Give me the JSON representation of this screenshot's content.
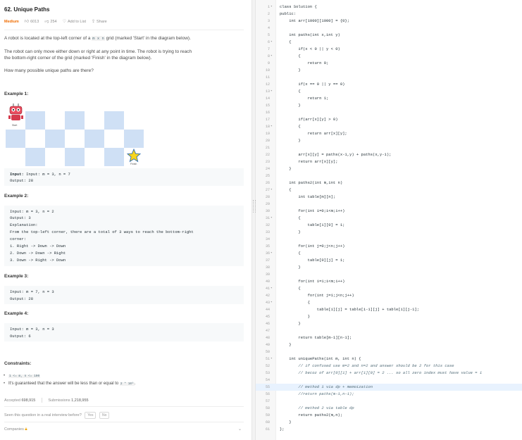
{
  "problem": {
    "title": "62. Unique Paths",
    "difficulty": "Medium",
    "likes": "6013",
    "dislikes": "254",
    "add_to_list": "Add to List",
    "share": "Share",
    "desc1_a": "A robot is located at the top-left corner of a ",
    "desc1_code": "m x n",
    "desc1_b": " grid (marked 'Start' in the diagram below).",
    "desc2_l1": "The robot can only move either down or right at any point in time. The robot is trying to reach",
    "desc2_l2": "the bottom-right corner of the grid (marked 'Finish' in the diagram below).",
    "desc3": "How many possible unique paths are there?",
    "start_label": "Start",
    "finish_label": "Finish",
    "examples": [
      {
        "title": "Example 1:",
        "lines": [
          "Input: m = 3, n = 7",
          "Output: 28"
        ]
      },
      {
        "title": "Example 2:",
        "lines": [
          "Input: m = 3, n = 2",
          "Output: 3",
          "Explanation:",
          "From the top-left corner, there are a total of 3 ways to reach the bottom-right",
          "corner:",
          "1. Right -> Down -> Down",
          "2. Down -> Down -> Right",
          "3. Down -> Right -> Down"
        ]
      },
      {
        "title": "Example 3:",
        "lines": [
          "Input: m = 7, n = 3",
          "Output: 28"
        ]
      },
      {
        "title": "Example 4:",
        "lines": [
          "Input: m = 3, n = 3",
          "Output: 6"
        ]
      }
    ],
    "constraints_title": "Constraints:",
    "constraint1": "1 <= m, n <= 100",
    "constraint2_a": "It's guaranteed that the answer will be less than or equal to ",
    "constraint2_code": "2 * 10⁹",
    "constraint2_b": ".",
    "accepted_label": "Accepted",
    "accepted_value": "698,915",
    "submissions_label": "Submissions",
    "submissions_value": "1,218,955",
    "interview_q": "Seen this question in a real interview before?",
    "yes": "Yes",
    "no": "No",
    "companies": "Companies"
  },
  "editor": {
    "lines": [
      {
        "n": "1",
        "fold": true,
        "t": "class Solution {"
      },
      {
        "n": "2",
        "t": "public:"
      },
      {
        "n": "3",
        "t": "    int arr[1000][1000] = {0};"
      },
      {
        "n": "4",
        "t": ""
      },
      {
        "n": "5",
        "t": "    int paths(int x,int y)"
      },
      {
        "n": "6",
        "fold": true,
        "t": "    {"
      },
      {
        "n": "7",
        "t": "        if(x < 0 || y < 0)"
      },
      {
        "n": "8",
        "fold": true,
        "t": "        {"
      },
      {
        "n": "9",
        "t": "            return 0;"
      },
      {
        "n": "10",
        "t": "        }"
      },
      {
        "n": "11",
        "t": ""
      },
      {
        "n": "12",
        "t": "        if(x == 0 || y == 0)"
      },
      {
        "n": "13",
        "fold": true,
        "t": "        {"
      },
      {
        "n": "14",
        "t": "            return 1;"
      },
      {
        "n": "15",
        "t": "        }"
      },
      {
        "n": "16",
        "t": ""
      },
      {
        "n": "17",
        "t": "        if(arr[x][y] > 0)"
      },
      {
        "n": "18",
        "fold": true,
        "t": "        {"
      },
      {
        "n": "19",
        "t": "            return arr[x][y];"
      },
      {
        "n": "20",
        "t": "        }"
      },
      {
        "n": "21",
        "t": ""
      },
      {
        "n": "22",
        "t": "        arr[x][y] = paths(x-1,y) + paths(x,y-1);"
      },
      {
        "n": "23",
        "t": "        return arr[x][y];"
      },
      {
        "n": "24",
        "t": "    }"
      },
      {
        "n": "25",
        "t": ""
      },
      {
        "n": "26",
        "t": "    int paths2(int m,int n)"
      },
      {
        "n": "27",
        "fold": true,
        "t": "    {"
      },
      {
        "n": "28",
        "t": "        int table[m][n];"
      },
      {
        "n": "29",
        "t": ""
      },
      {
        "n": "30",
        "t": "        for(int i=0;i<m;i++)"
      },
      {
        "n": "31",
        "fold": true,
        "t": "        {"
      },
      {
        "n": "32",
        "t": "            table[i][0] = 1;"
      },
      {
        "n": "33",
        "t": "        }"
      },
      {
        "n": "34",
        "t": ""
      },
      {
        "n": "35",
        "t": "        for(int j=0;j<n;j++)"
      },
      {
        "n": "36",
        "fold": true,
        "t": "        {"
      },
      {
        "n": "37",
        "t": "            table[0][j] = 1;"
      },
      {
        "n": "38",
        "t": "        }"
      },
      {
        "n": "39",
        "t": ""
      },
      {
        "n": "40",
        "t": "        for(int i=1;i<m;i++)"
      },
      {
        "n": "41",
        "fold": true,
        "t": "        {"
      },
      {
        "n": "42",
        "t": "            for(int j=1;j<n;j++)"
      },
      {
        "n": "43",
        "fold": true,
        "t": "            {"
      },
      {
        "n": "44",
        "t": "                table[i][j] = table[i-1][j] + table[i][j-1];"
      },
      {
        "n": "45",
        "t": "            }"
      },
      {
        "n": "46",
        "t": "        }"
      },
      {
        "n": "47",
        "t": ""
      },
      {
        "n": "48",
        "t": "        return table[m-1][n-1];"
      },
      {
        "n": "49",
        "t": "    }"
      },
      {
        "n": "50",
        "t": ""
      },
      {
        "n": "51",
        "fold": true,
        "t": "    int uniquePaths(int m, int n) {"
      },
      {
        "n": "52",
        "cm": true,
        "t": "        // if confused use m=2 and n=2 and answer should be 2 for this case"
      },
      {
        "n": "53",
        "cm": true,
        "t": "        // becoz of arr[0][1] + arr[1][0] = 2 ... so all zero index must have value = 1"
      },
      {
        "n": "54",
        "t": ""
      },
      {
        "n": "55",
        "cm": true,
        "hl": true,
        "t": "        // method 1 via dp + memoization"
      },
      {
        "n": "56",
        "cm": true,
        "t": "        //return paths(m-1,n-1);"
      },
      {
        "n": "57",
        "t": ""
      },
      {
        "n": "58",
        "cm": true,
        "t": "        // method 2 via table dp"
      },
      {
        "n": "59",
        "t": "        return paths2(m,n);"
      },
      {
        "n": "60",
        "t": "    }"
      },
      {
        "n": "61",
        "t": "};"
      }
    ]
  }
}
